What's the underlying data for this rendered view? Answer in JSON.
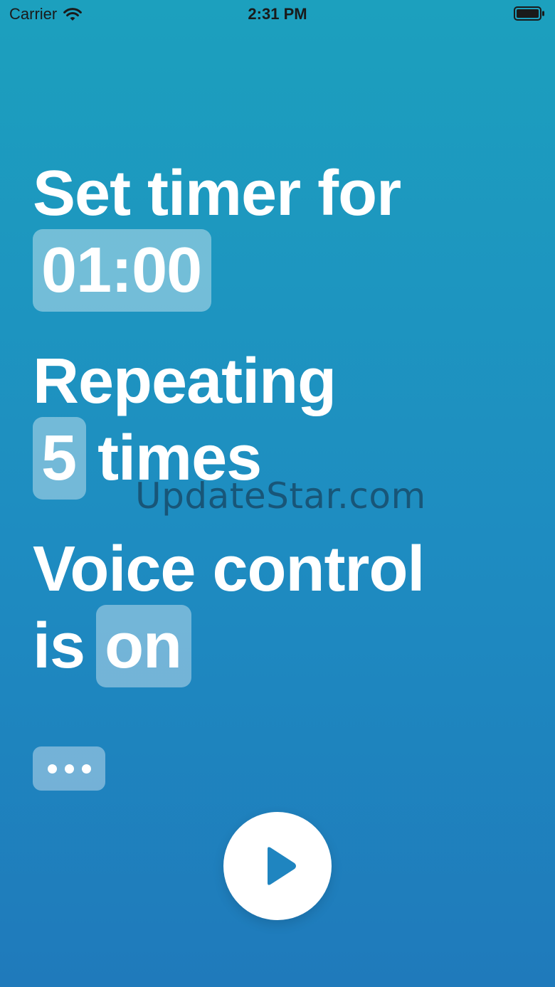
{
  "status_bar": {
    "carrier": "Carrier",
    "time": "2:31 PM",
    "icons": [
      "wifi-icon",
      "battery-icon"
    ]
  },
  "timer": {
    "label": "Set timer for",
    "value": "01:00"
  },
  "repeat": {
    "label": "Repeating",
    "count": "5",
    "suffix": "times"
  },
  "voice": {
    "label": "Voice control",
    "prefix": "is",
    "state": "on"
  },
  "more_button": {
    "icon": "ellipsis-icon"
  },
  "play_button": {
    "icon": "play-icon"
  },
  "watermark": "UpdateStar.com",
  "colors": {
    "background_top": "#1ca0be",
    "background_bottom": "#1f7abb",
    "text": "#ffffff",
    "pill": "rgba(255,255,255,0.38)",
    "play_icon": "#1f85c0"
  }
}
